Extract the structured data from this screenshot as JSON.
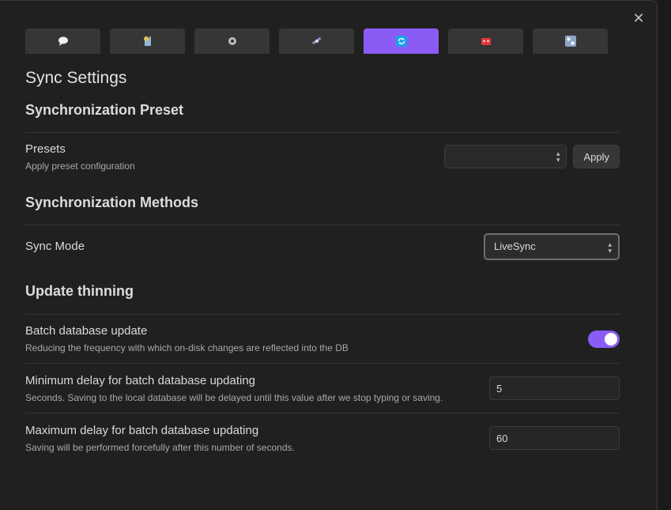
{
  "tabs": [
    {
      "icon": "speech-bubble-icon"
    },
    {
      "icon": "satellite-dish-icon"
    },
    {
      "icon": "gear-icon"
    },
    {
      "icon": "satellite-icon"
    },
    {
      "icon": "sync-icon"
    },
    {
      "icon": "robot-icon"
    },
    {
      "icon": "control-knobs-icon"
    }
  ],
  "accent": "#8a5cf5",
  "page_title": "Sync Settings",
  "sections": {
    "preset": {
      "heading": "Synchronization Preset",
      "presets_label": "Presets",
      "presets_desc": "Apply preset configuration",
      "presets_value": "",
      "apply_label": "Apply"
    },
    "methods": {
      "heading": "Synchronization Methods",
      "sync_mode_label": "Sync Mode",
      "sync_mode_value": "LiveSync"
    },
    "thinning": {
      "heading": "Update thinning",
      "batch_label": "Batch database update",
      "batch_desc": "Reducing the frequency with which on-disk changes are reflected into the DB",
      "batch_enabled": true,
      "min_label": "Minimum delay for batch database updating",
      "min_desc": "Seconds. Saving to the local database will be delayed until this value after we stop typing or saving.",
      "min_value": "5",
      "max_label": "Maximum delay for batch database updating",
      "max_desc": "Saving will be performed forcefully after this number of seconds.",
      "max_value": "60"
    }
  }
}
